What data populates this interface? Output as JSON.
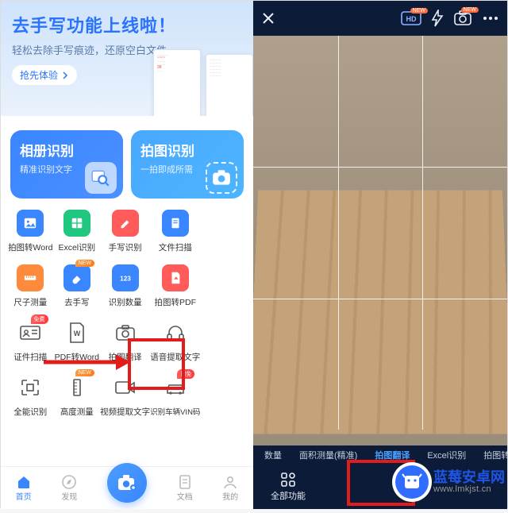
{
  "left": {
    "banner": {
      "title": "去手写功能上线啦！",
      "subtitle": "轻松去除手写痕迹，还原空白文件",
      "cta": "抢先体验"
    },
    "cards": [
      {
        "title": "相册识别",
        "sub": "精准识别文字",
        "icon": "gallery-magnify-icon"
      },
      {
        "title": "拍图识别",
        "sub": "一拍即成所需",
        "icon": "camera-icon"
      }
    ],
    "grid": [
      {
        "label": "拍图转Word",
        "icon": "picture-icon",
        "bg": "#3a86ff",
        "badge": null
      },
      {
        "label": "Excel识别",
        "icon": "grid-icon",
        "bg": "#1fc77f",
        "badge": null
      },
      {
        "label": "手写识别",
        "icon": "pen-icon",
        "bg": "#ff5b5b",
        "badge": null
      },
      {
        "label": "文件扫描",
        "icon": "scan-icon",
        "bg": "#3a86ff",
        "badge": null
      },
      {
        "label": "",
        "icon": "",
        "bg": "",
        "badge": null
      },
      {
        "label": "尺子测量",
        "icon": "ruler-icon",
        "bg": "#ff8a3c",
        "badge": null
      },
      {
        "label": "去手写",
        "icon": "eraser-icon",
        "bg": "#3a86ff",
        "badge": "NEW"
      },
      {
        "label": "识别数量",
        "icon": "count-icon",
        "bg": "#3a86ff",
        "badge": null
      },
      {
        "label": "拍图转PDF",
        "icon": "pdf-icon",
        "bg": "#ff5b5b",
        "badge": null
      },
      {
        "label": "",
        "icon": "",
        "bg": "",
        "badge": null
      },
      {
        "label": "证件扫描",
        "icon": "id-icon",
        "bg": "",
        "badge": "免费"
      },
      {
        "label": "PDF转Word",
        "icon": "word-icon",
        "bg": "",
        "badge": null
      },
      {
        "label": "拍图翻译",
        "icon": "camera-translate-icon",
        "bg": "",
        "badge": null
      },
      {
        "label": "语音提取文字",
        "icon": "headphone-icon",
        "bg": "",
        "badge": null
      },
      {
        "label": "",
        "icon": "",
        "bg": "",
        "badge": null
      },
      {
        "label": "全能识别",
        "icon": "all-icon",
        "bg": "",
        "badge": null
      },
      {
        "label": "高度测量",
        "icon": "height-icon",
        "bg": "",
        "badge": "NEW"
      },
      {
        "label": "视频提取文字",
        "icon": "video-icon",
        "bg": "",
        "badge": null
      },
      {
        "label": "识别车辆VIN码",
        "icon": "vin-icon",
        "bg": "",
        "badge": "限免"
      },
      {
        "label": "",
        "icon": "",
        "bg": "",
        "badge": null
      }
    ],
    "nav": {
      "home": "首页",
      "discover": "发现",
      "docs": "文档",
      "mine": "我的"
    }
  },
  "right": {
    "top_badges": {
      "hd": "HD",
      "new": "NEW"
    },
    "strip": {
      "items": [
        {
          "label": "数量",
          "selected": false
        },
        {
          "label": "面积测量(精准)",
          "selected": false
        },
        {
          "label": "拍图翻译",
          "selected": true
        },
        {
          "label": "Excel识别",
          "selected": false
        },
        {
          "label": "拍图转Wo",
          "selected": false
        }
      ]
    },
    "bottom": {
      "all": "全部功能"
    }
  },
  "watermark": {
    "title": "蓝莓安卓网",
    "url": "www.lmkjst.cn"
  },
  "colors": {
    "accent": "#3a86ff",
    "danger": "#e21b1b"
  }
}
